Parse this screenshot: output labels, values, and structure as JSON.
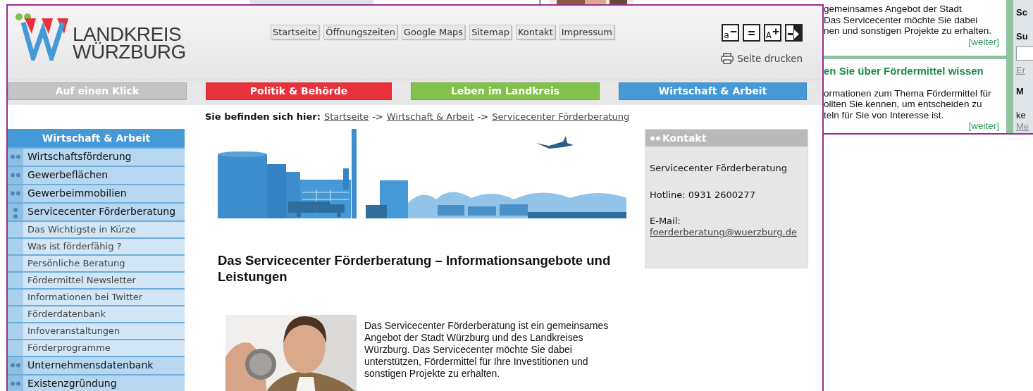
{
  "background_page": {
    "teasers": [
      {
        "lines": [
          "gemeinsames Angebot der Stadt",
          "Das Servicecenter möchte Sie dabei",
          "nen und sonstigen Projekte zu erhalten."
        ],
        "more": "[weiter]"
      },
      {
        "title": "en Sie über Fördermittel wissen",
        "lines": [
          "ormationen zum Thema Fördermittel für",
          "ollten Sie kennen, um entscheiden zu",
          "teln für Sie von Interesse ist."
        ],
        "more": "[weiter]"
      }
    ],
    "side_items": [
      {
        "kind": "heading",
        "text": "Sc"
      },
      {
        "kind": "heading",
        "text": "Su"
      },
      {
        "kind": "field"
      },
      {
        "kind": "link",
        "text": "Er"
      },
      {
        "kind": "heading",
        "text": "M"
      },
      {
        "kind": "text",
        "text": "ke"
      },
      {
        "kind": "link",
        "text": "Me"
      }
    ]
  },
  "window": {
    "logo": {
      "line_1": "LANDKREIS",
      "line_2": "WÜRZBURG"
    },
    "top_links": [
      "Startseite",
      "Öffnungszeiten",
      "Google Maps",
      "Sitemap",
      "Kontakt",
      "Impressum"
    ],
    "font_buttons": [
      {
        "kind": "decrease",
        "letter": "a",
        "sign": "−"
      },
      {
        "kind": "reset",
        "sign": "="
      },
      {
        "kind": "increase",
        "letter": "A",
        "sign": "+"
      },
      {
        "kind": "contrast"
      }
    ],
    "print": "Seite drucken",
    "categories": [
      {
        "label": "Auf einen Klick",
        "color": "#c4c4c6"
      },
      {
        "label": "Politik & Behörde",
        "color": "#e8313a"
      },
      {
        "label": "Leben im Landkreis",
        "color": "#80c24b"
      },
      {
        "label": "Wirtschaft & Arbeit",
        "color": "#4499d6"
      }
    ],
    "breadcrumb": [
      {
        "kind": "label",
        "text": "Sie befinden sich hier:"
      },
      {
        "kind": "link",
        "text": "Startseite"
      },
      {
        "kind": "separator",
        "text": "->"
      },
      {
        "kind": "link",
        "text": "Wirtschaft & Arbeit"
      },
      {
        "kind": "separator",
        "text": "->"
      },
      {
        "kind": "link",
        "text": "Servicecenter Förderberatung"
      }
    ],
    "sidebar": {
      "title": "Wirtschaft & Arbeit",
      "items": [
        {
          "label": "Wirtschaftsförderung",
          "expanded": false
        },
        {
          "label": "Gewerbeflächen",
          "expanded": false
        },
        {
          "label": "Gewerbeimmobilien",
          "expanded": false
        },
        {
          "label": "Servicecenter Förderberatung",
          "expanded": true,
          "children": [
            {
              "label": "Das Wichtigste in Kürze"
            },
            {
              "label": "Was ist förderfähig ?"
            },
            {
              "label": "Persönliche Beratung"
            },
            {
              "label": "Fördermittel Newsletter"
            },
            {
              "label": "Informationen bei Twitter"
            },
            {
              "label": "Förderdatenbank"
            },
            {
              "label": "Infoveranstaltungen"
            },
            {
              "label": "Förderprogramme"
            }
          ]
        },
        {
          "label": "Unternehmensdatenbank",
          "expanded": false
        },
        {
          "label": "Existenzgründung",
          "expanded": false
        }
      ]
    },
    "content": {
      "heading": "Das Servicecenter Förderberatung – Informationsangebote und Leistungen",
      "intro": "Das Servicecenter Förderberatung ist ein gemeinsames Angebot der Stadt Würzburg und des Landkreises Würzburg. Das Servicecenter möchte Sie dabei unterstützen, Fördermittel für Ihre Investitionen und sonstigen Projekte zu erhalten."
    },
    "contact": {
      "title": "Kontakt",
      "lines": [
        {
          "kind": "text",
          "text": "Servicecenter Förderberatung"
        },
        {
          "kind": "text",
          "text": "Hotline: 0931 2600277"
        },
        {
          "kind": "label",
          "text": "E-Mail:"
        },
        {
          "kind": "link",
          "text": "foerderberatung@wuerzburg.de"
        }
      ]
    }
  }
}
